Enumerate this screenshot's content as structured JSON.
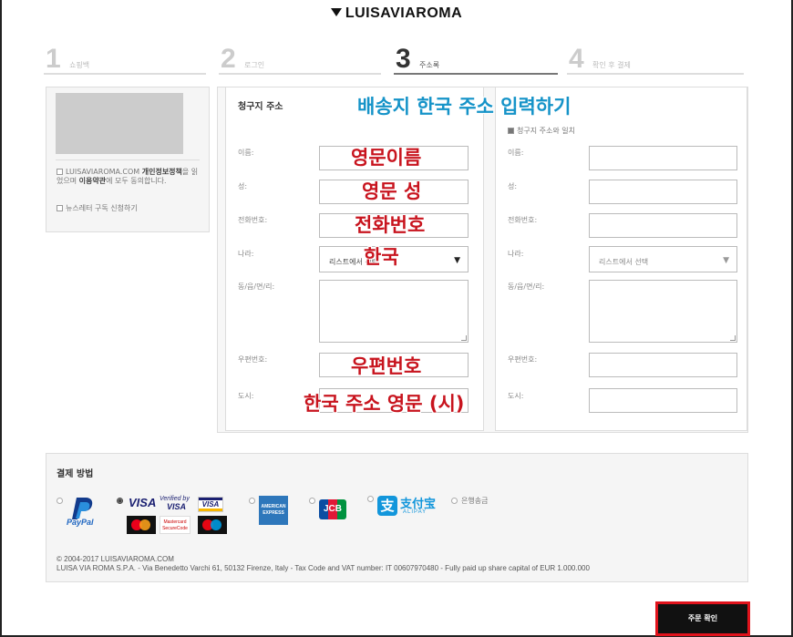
{
  "brand": {
    "logo_text": "LUISAVIAROMA"
  },
  "steps": [
    {
      "num": "1",
      "label": "쇼핑백"
    },
    {
      "num": "2",
      "label": "로그인"
    },
    {
      "num": "3",
      "label": "주소록"
    },
    {
      "num": "4",
      "label": "확인 후 결제"
    }
  ],
  "left_panel": {
    "privacy_text_1": "LUISAVIAROMA.COM ",
    "privacy_bold_1": "개인정보정책",
    "privacy_text_2": "을 읽었으며 ",
    "privacy_bold_2": "이용약관",
    "privacy_text_3": "에 모두 동의합니다.",
    "newsletter": "뉴스레터 구독 신청하기"
  },
  "billing": {
    "title": "청구지 주소",
    "labels": {
      "first_name": "이름:",
      "last_name": "성:",
      "phone": "전화번호:",
      "country": "나라:",
      "address": "동/읍/면/리:",
      "postal": "우편번호:",
      "city": "도시:"
    },
    "country_value": "리스트에서 선택"
  },
  "shipping": {
    "same_as_billing": "청구지 주소와 일치",
    "labels": {
      "first_name": "이름:",
      "last_name": "성:",
      "phone": "전화번호:",
      "country": "나라:",
      "address": "동/읍/면/리:",
      "postal": "우편번호:",
      "city": "도시:"
    },
    "country_value": "리스트에서 선택"
  },
  "annotations": {
    "shipping_korea": "배송지 한국 주소 입력하기",
    "english_first_name": "영문이름",
    "english_last_name": "영문 성",
    "phone": "전화번호",
    "korea": "한국",
    "postal": "우편번호",
    "address_en_city": "한국 주소 영문 (시)"
  },
  "payment": {
    "title": "결제 방법",
    "paypal": "PayPal",
    "visa": "VISA",
    "verified_by": "Verified by",
    "amex_top": "AMERICAN",
    "amex_bottom": "EXPRESS",
    "jcb": "JCB",
    "alipay_cn": "支付宝",
    "alipay_en": "ALIPAY",
    "bank_transfer": "은행송금",
    "mastercard": "Mastercard",
    "securecode": "SecureCode",
    "selected": "visa"
  },
  "footer": {
    "copyright": "© 2004-2017 LUISAVIAROMA.COM",
    "company": "LUISA VIA ROMA S.P.A. - Via Benedetto Varchi 61, 50132 Firenze, Italy - Tax Code and VAT number: IT 00607970480 - Fully paid up share capital of EUR 1.000.000"
  },
  "actions": {
    "confirm_order": "주문 확인"
  },
  "colors": {
    "annotation_red": "#c8141e",
    "annotation_blue": "#1593c8",
    "button_border": "#e0131c"
  }
}
